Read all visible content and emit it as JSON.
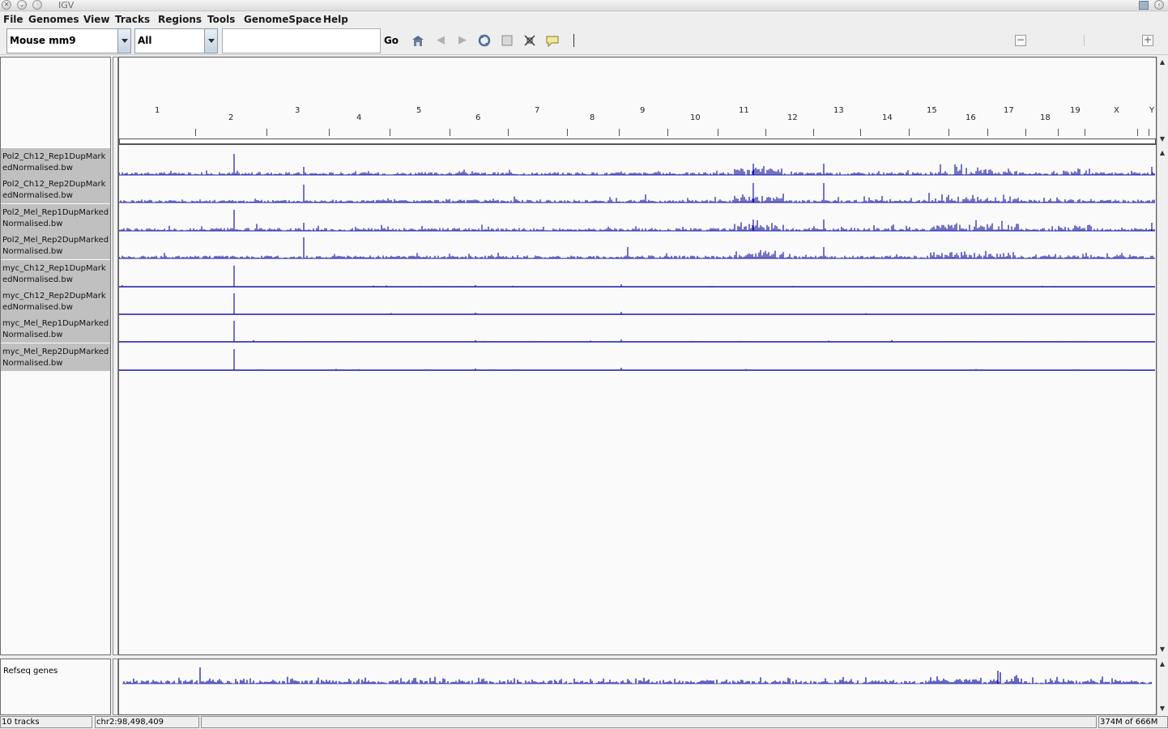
{
  "window": {
    "title": "IGV"
  },
  "menu": [
    "File",
    "Genomes",
    "View",
    "Tracks",
    "Regions",
    "Tools",
    "GenomeSpace",
    "Help"
  ],
  "toolbar": {
    "genome": "Mouse mm9",
    "chromosome": "All",
    "locus_value": "",
    "go_label": "Go",
    "icons": [
      "home-icon",
      "back-icon",
      "forward-icon",
      "refresh-icon",
      "roi-icon",
      "fit-to-window-icon",
      "popup-info-icon"
    ],
    "zoom_out": "−",
    "zoom_in": "+"
  },
  "ruler": {
    "chromosomes": [
      "1",
      "2",
      "3",
      "4",
      "5",
      "6",
      "7",
      "8",
      "9",
      "10",
      "11",
      "12",
      "13",
      "14",
      "15",
      "16",
      "17",
      "18",
      "19",
      "X",
      "Y"
    ]
  },
  "tracks": [
    {
      "name": "Pol2_Ch12_Rep1DupMarkedNormalised.bw",
      "profile": "pol2a"
    },
    {
      "name": "Pol2_Ch12_Rep2DupMarkedNormalised.bw",
      "profile": "pol2b"
    },
    {
      "name": "Pol2_Mel_Rep1DupMarkedNormalised.bw",
      "profile": "pol2a"
    },
    {
      "name": "Pol2_Mel_Rep2DupMarkedNormalised.bw",
      "profile": "pol2c"
    },
    {
      "name": "myc_Ch12_Rep1DupMarkedNormalised.bw",
      "profile": "myc"
    },
    {
      "name": "myc_Ch12_Rep2DupMarkedNormalised.bw",
      "profile": "myc"
    },
    {
      "name": "myc_Mel_Rep1DupMarkedNormalised.bw",
      "profile": "myc"
    },
    {
      "name": "myc_Mel_Rep2DupMarkedNormalised.bw",
      "profile": "myc"
    }
  ],
  "feature_track": {
    "name": "Refseq genes"
  },
  "colors": {
    "signal": "#1a1aa8",
    "track_label_bg": "#c0c0c0"
  },
  "status": {
    "tracks": "10 tracks",
    "position": "chr2:98,498,409",
    "message": "",
    "memory": "374M of 666M"
  }
}
